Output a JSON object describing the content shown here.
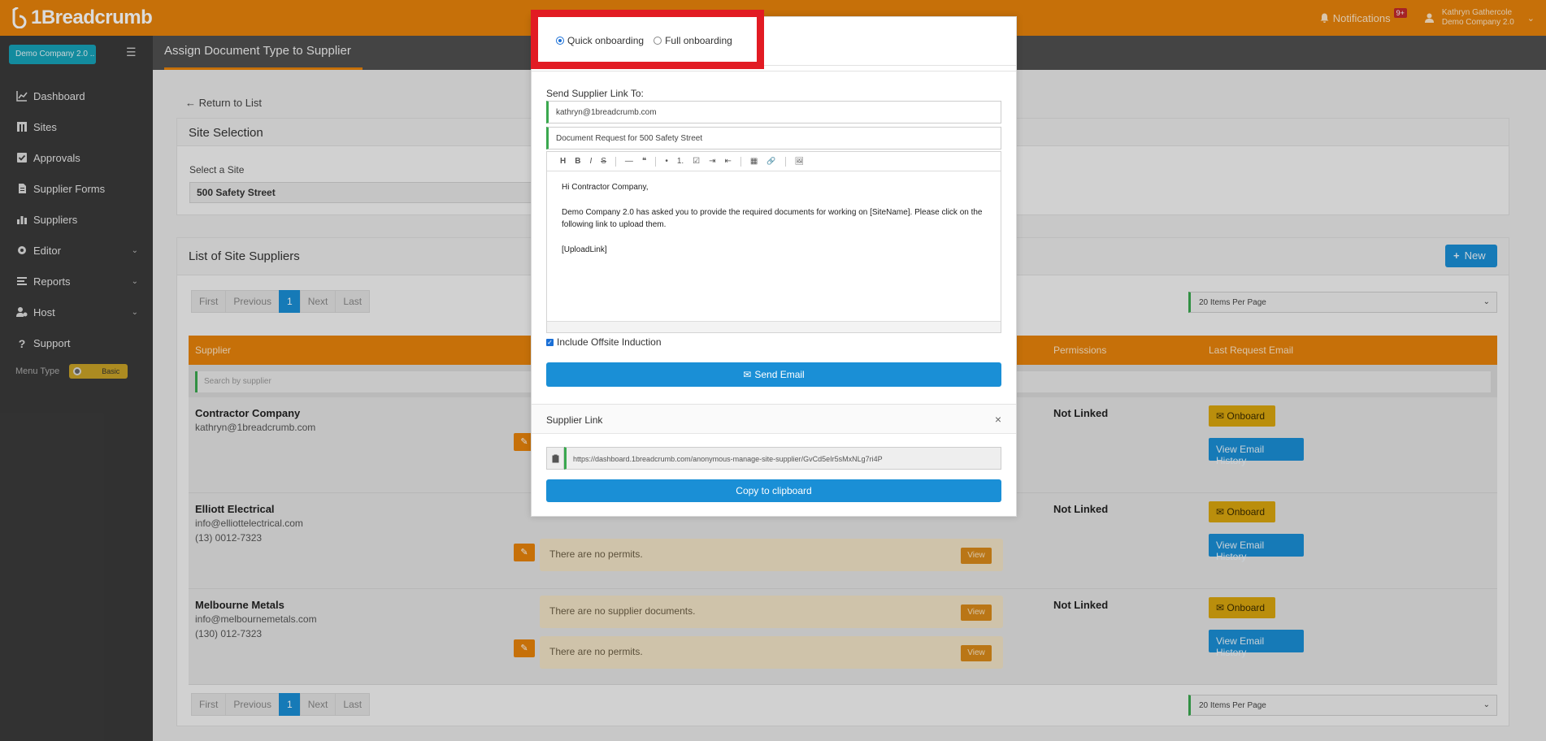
{
  "brand": {
    "name": "1Breadcrumb"
  },
  "header": {
    "notifications_label": "Notifications",
    "notifications_count": "9+",
    "user_name": "Kathryn Gathercole",
    "user_company": "Demo Company 2.0"
  },
  "sidebar": {
    "company": "Demo Company 2.0 ..",
    "items": [
      {
        "label": "Dashboard",
        "icon": "chart-line-icon",
        "expandable": false
      },
      {
        "label": "Sites",
        "icon": "building-icon",
        "expandable": false
      },
      {
        "label": "Approvals",
        "icon": "check-square-icon",
        "expandable": false
      },
      {
        "label": "Supplier Forms",
        "icon": "file-icon",
        "expandable": false
      },
      {
        "label": "Suppliers",
        "icon": "bar-chart-icon",
        "expandable": false
      },
      {
        "label": "Editor",
        "icon": "gear-icon",
        "expandable": true
      },
      {
        "label": "Reports",
        "icon": "list-icon",
        "expandable": true
      },
      {
        "label": "Host",
        "icon": "user-gear-icon",
        "expandable": true
      },
      {
        "label": "Support",
        "icon": "question-icon",
        "expandable": false
      }
    ],
    "menu_type_label": "Menu Type",
    "menu_type_value": "Basic"
  },
  "page": {
    "title": "Assign Document Type to Supplier",
    "return_link": "Return to List",
    "site_selection": {
      "heading": "Site Selection",
      "label": "Select a Site",
      "value": "500 Safety Street"
    },
    "list": {
      "heading": "List of Site Suppliers",
      "new_button": "New",
      "pager": [
        "First",
        "Previous",
        "1",
        "Next",
        "Last"
      ],
      "items_per_page": "20 Items Per Page",
      "columns": [
        "Supplier",
        "Permissions",
        "Last Request Email"
      ],
      "search_placeholder": "Search by supplier",
      "rows": [
        {
          "name": "Contractor Company",
          "email": "kathryn@1breadcrumb.com",
          "phone": "",
          "permissions": "Not Linked",
          "docs": "",
          "permits": ""
        },
        {
          "name": "Elliott Electrical",
          "email": "info@elliottelectrical.com",
          "phone": "(13) 0012-7323",
          "permissions": "Not Linked",
          "docs": "",
          "permits": "There are no permits."
        },
        {
          "name": "Melbourne Metals",
          "email": "info@melbournemetals.com",
          "phone": "(130) 012-7323",
          "permissions": "Not Linked",
          "docs": "There are no supplier documents.",
          "permits": "There are no permits."
        }
      ],
      "view_label": "View",
      "onboard_label": "Onboard",
      "email_history_label": "View Email History"
    }
  },
  "modal": {
    "options": [
      {
        "label": "Quick onboarding",
        "selected": true
      },
      {
        "label": "Full onboarding",
        "selected": false
      }
    ],
    "send_to_label": "Send Supplier Link To:",
    "to_value": "kathryn@1breadcrumb.com",
    "subject_value": "Document Request for 500 Safety Street",
    "toolbar": [
      "H",
      "B",
      "I",
      "S",
      "—",
      "❝",
      "•",
      "1.",
      "☑",
      "⇥",
      "⇤",
      "▦",
      "🔗",
      "🖼"
    ],
    "body": {
      "greeting": "Hi Contractor Company,",
      "paragraph": "Demo Company 2.0 has asked you to provide the required documents for working on [SiteName]. Please click on the following link to upload them.",
      "link_token": "[UploadLink]"
    },
    "include_offsite": "Include Offsite Induction",
    "send_email_button": "Send Email",
    "link_panel": {
      "heading": "Supplier Link",
      "url": "https://dashboard.1breadcrumb.com/anonymous-manage-site-supplier/GvCd5eIr5sMxNLg7ri4P",
      "copy_button": "Copy to clipboard"
    }
  },
  "colors": {
    "brand_orange": "#e7830b",
    "primary_blue": "#1a8fd6",
    "highlight_red": "#e21b23",
    "sidebar_dark": "#3a3a3a"
  }
}
